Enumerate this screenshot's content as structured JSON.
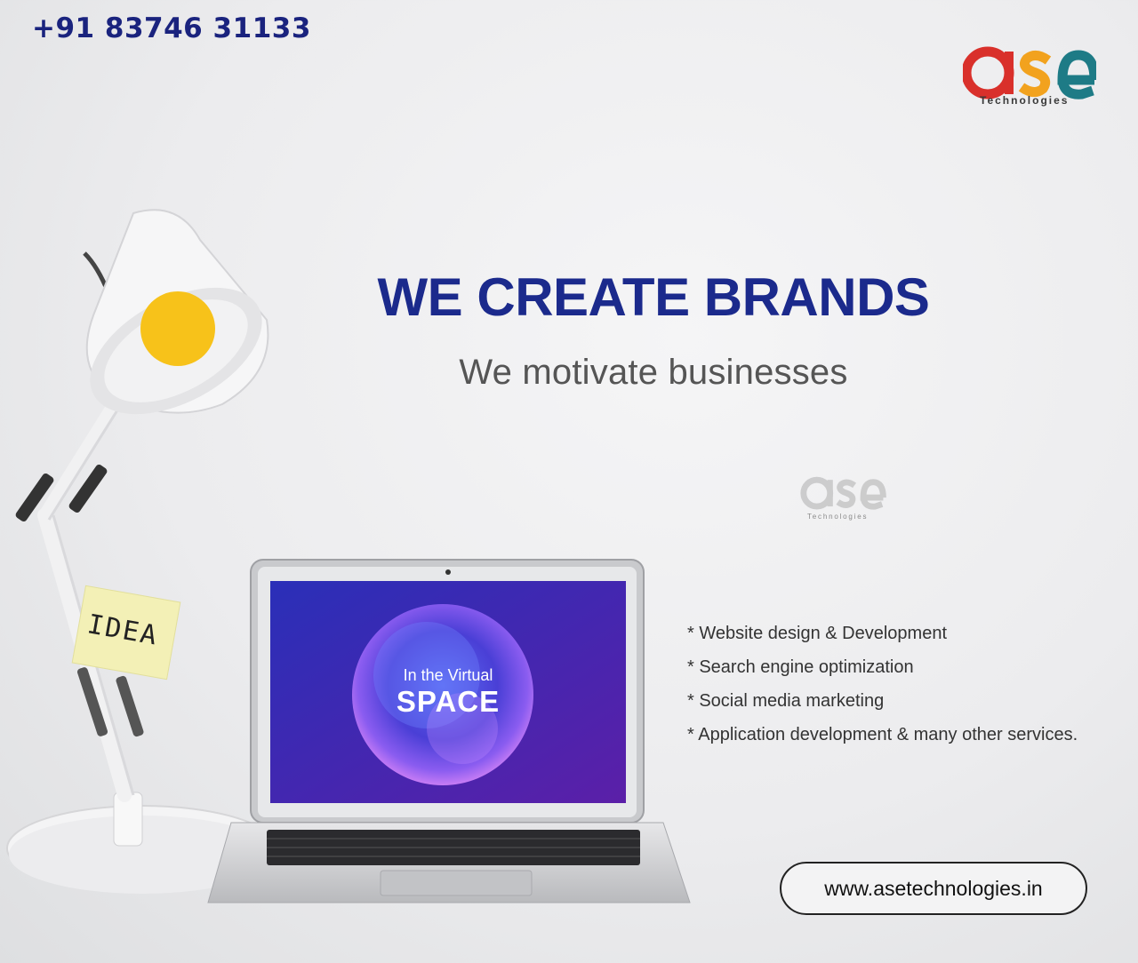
{
  "phone": "+91 83746 31133",
  "logo": {
    "word": "ase",
    "subtitle": "Technologies"
  },
  "watermark": {
    "word": "ase",
    "subtitle": "Technologies"
  },
  "headline": "WE CREATE BRANDS",
  "subheadline": "We motivate businesses",
  "services": [
    "* Website design & Development",
    "* Search engine optimization",
    "* Social media marketing",
    "* Application development & many other services."
  ],
  "website": "www.asetechnologies.in",
  "sticky_note": "IDEA",
  "screen": {
    "line1": "In the Virtual",
    "line2": "SPACE"
  },
  "colors": {
    "brand_navy": "#1b2a8c",
    "logo_red": "#d9302b",
    "logo_orange": "#f2a21e",
    "logo_teal": "#1e7b86",
    "bulb": "#f7c21a"
  }
}
